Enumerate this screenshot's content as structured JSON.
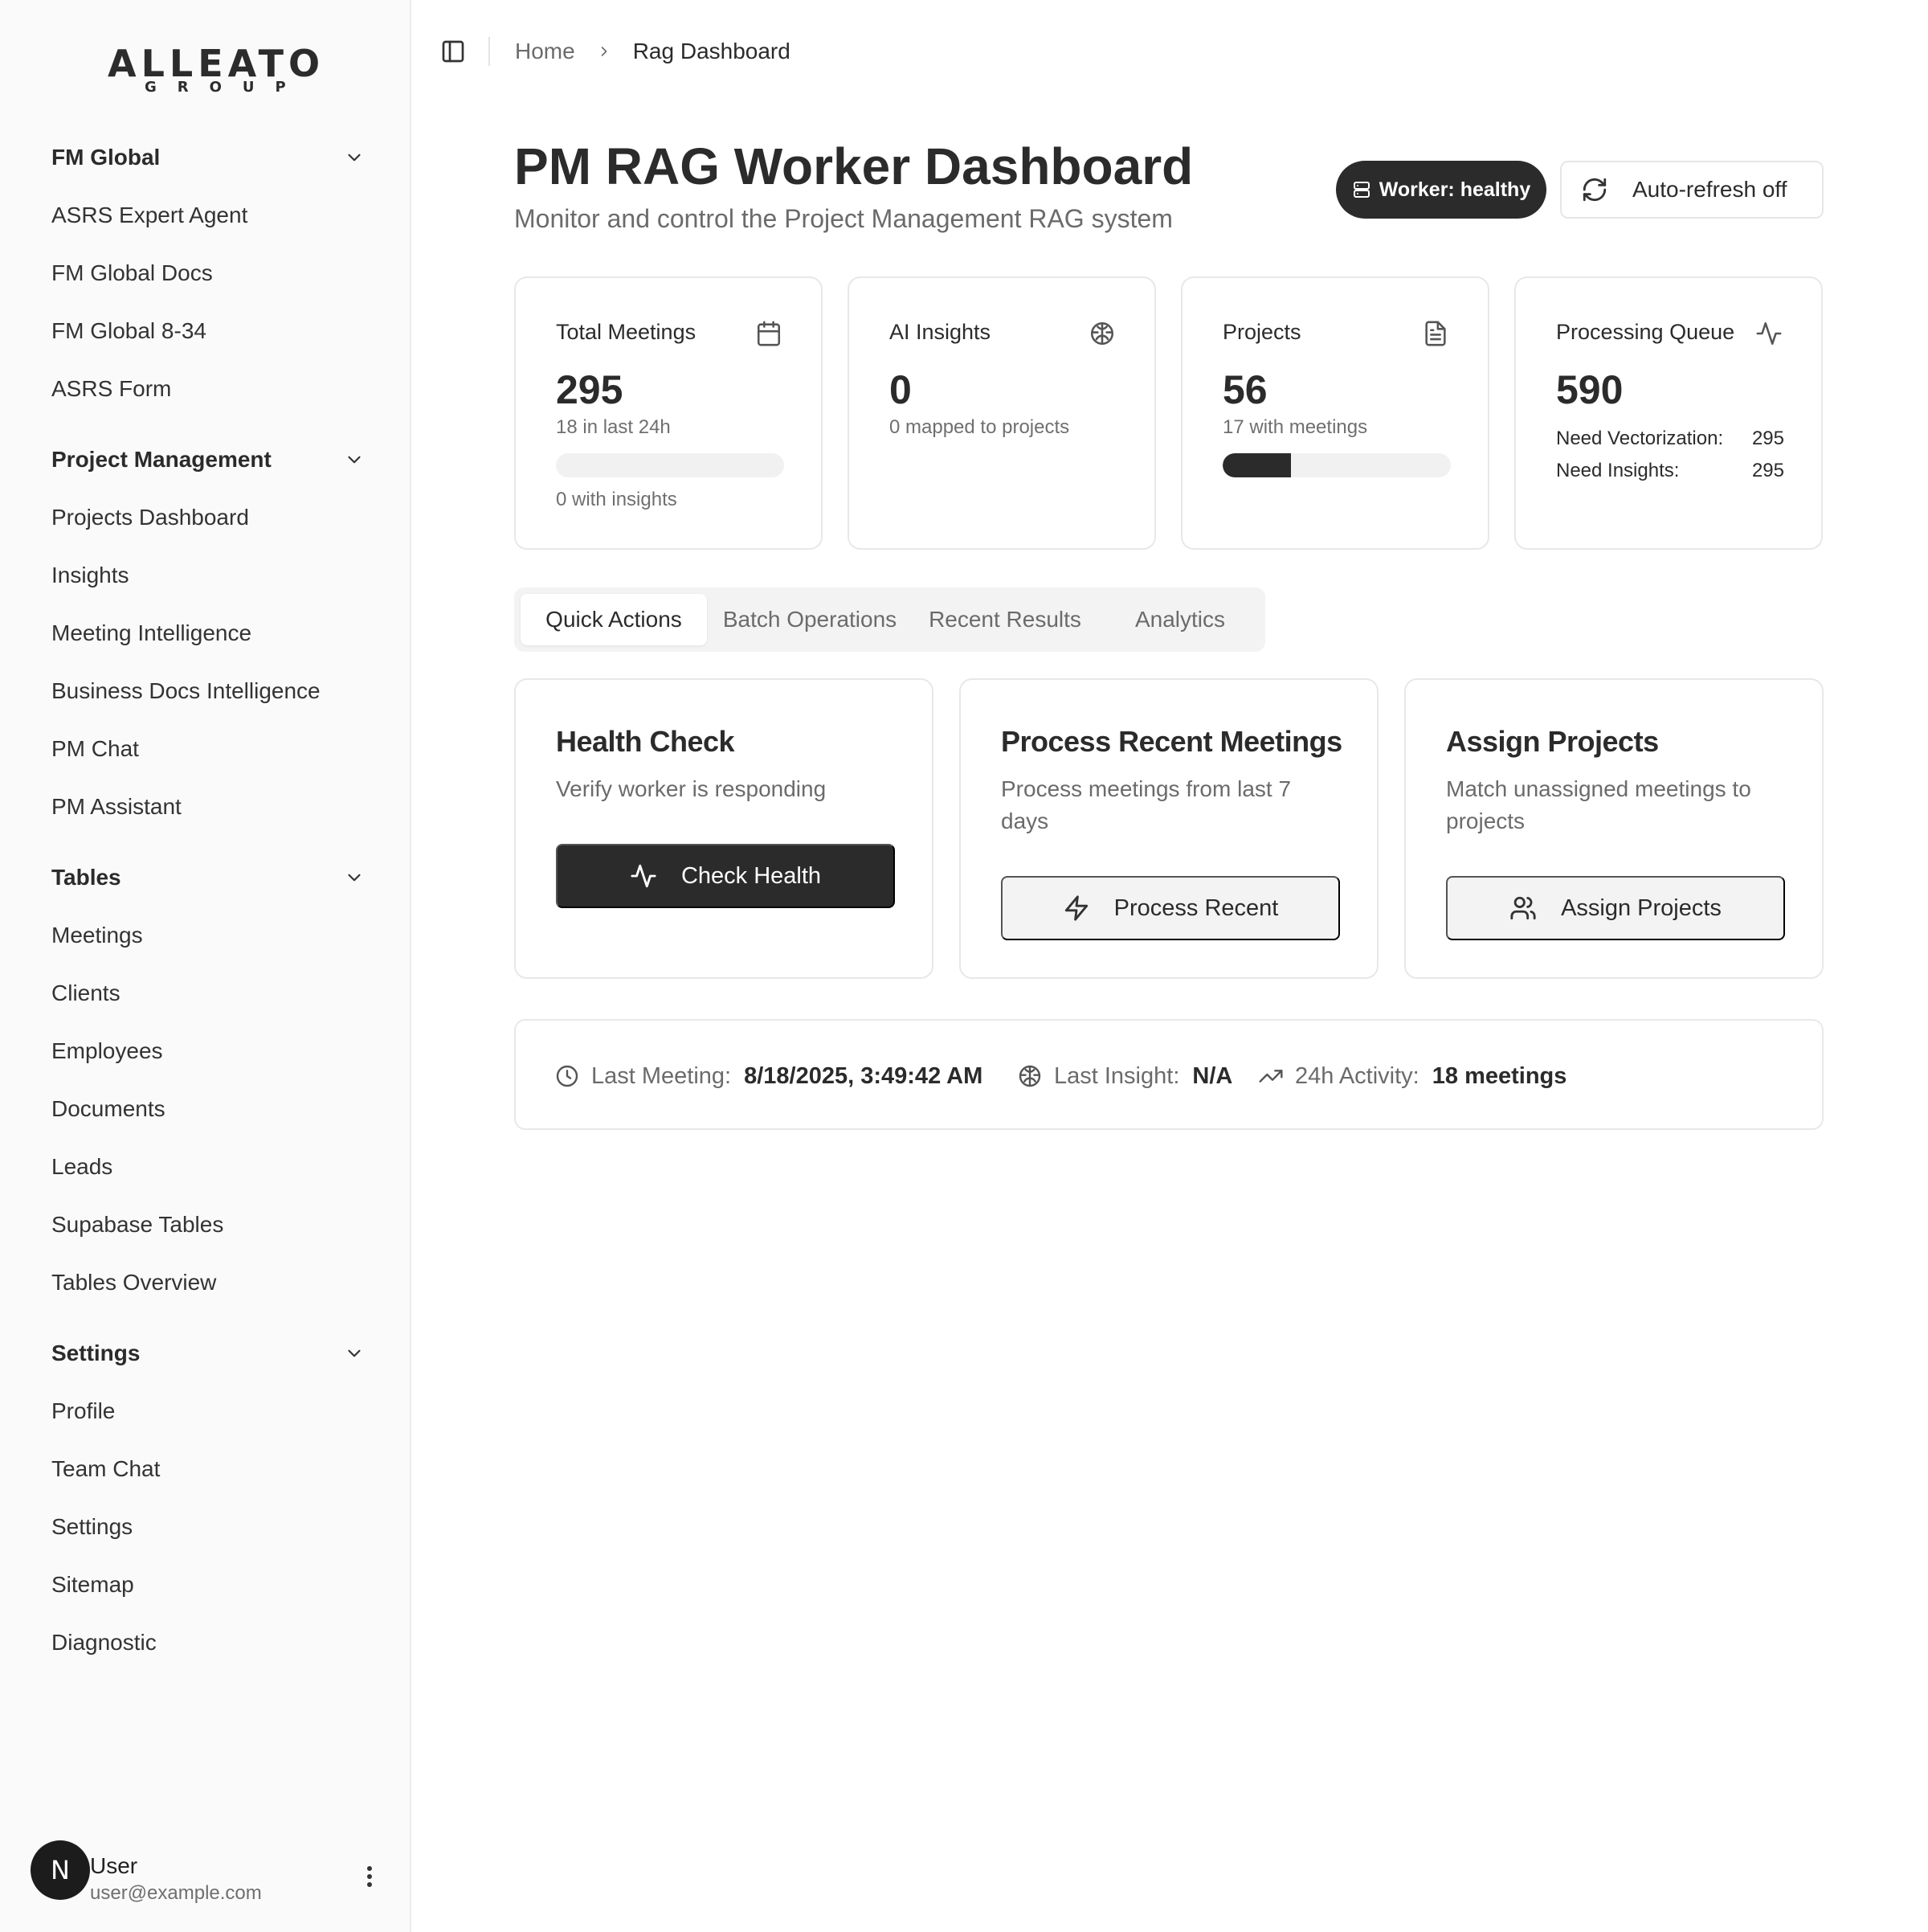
{
  "brand": {
    "name": "ALLEATO",
    "sub": "GROUP"
  },
  "sidebar": {
    "groups": [
      {
        "title": "FM Global",
        "items": [
          "ASRS Expert Agent",
          "FM Global Docs",
          "FM Global 8-34",
          "ASRS Form"
        ]
      },
      {
        "title": "Project Management",
        "items": [
          "Projects Dashboard",
          "Insights",
          "Meeting Intelligence",
          "Business Docs Intelligence",
          "PM Chat",
          "PM Assistant"
        ]
      },
      {
        "title": "Tables",
        "items": [
          "Meetings",
          "Clients",
          "Employees",
          "Documents",
          "Leads",
          "Supabase Tables",
          "Tables Overview"
        ]
      },
      {
        "title": "Settings",
        "items": [
          "Profile",
          "Team Chat",
          "Settings",
          "Sitemap",
          "Diagnostic"
        ]
      }
    ],
    "user": {
      "initial": "N",
      "name": "User",
      "email": "user@example.com"
    }
  },
  "breadcrumb": {
    "home": "Home",
    "current": "Rag Dashboard"
  },
  "header": {
    "title": "PM RAG Worker Dashboard",
    "subtitle": "Monitor and control the Project Management RAG system",
    "worker_status": "Worker: healthy",
    "refresh_label": "Auto-refresh off"
  },
  "stats": {
    "meetings": {
      "label": "Total Meetings",
      "value": "295",
      "sub": "18 in last 24h",
      "foot": "0 with insights",
      "progress": 0
    },
    "insights": {
      "label": "AI Insights",
      "value": "0",
      "sub": "0 mapped to projects"
    },
    "projects": {
      "label": "Projects",
      "value": "56",
      "sub": "17 with meetings",
      "progress": 0.3
    },
    "queue": {
      "label": "Processing Queue",
      "value": "590",
      "vector_label": "Need Vectorization:",
      "vector_value": "295",
      "insight_label": "Need Insights:",
      "insight_value": "295"
    }
  },
  "tabs": [
    "Quick Actions",
    "Batch Operations",
    "Recent Results",
    "Analytics"
  ],
  "actions": [
    {
      "title": "Health Check",
      "desc": "Verify worker is responding",
      "button": "Check Health"
    },
    {
      "title": "Process Recent Meetings",
      "desc": "Process meetings from last 7 days",
      "button": "Process Recent"
    },
    {
      "title": "Assign Projects",
      "desc": "Match unassigned meetings to projects",
      "button": "Assign Projects"
    }
  ],
  "status": {
    "last_meeting_label": "Last Meeting:",
    "last_meeting_value": "8/18/2025, 3:49:42 AM",
    "last_insight_label": "Last Insight:",
    "last_insight_value": "N/A",
    "activity_label": "24h Activity:",
    "activity_value": "18 meetings"
  },
  "colors": {
    "accent": "#2b2b2b",
    "muted": "#6b6b6b",
    "border": "#e8e8e8",
    "sidebar_bg": "#fafafa"
  }
}
